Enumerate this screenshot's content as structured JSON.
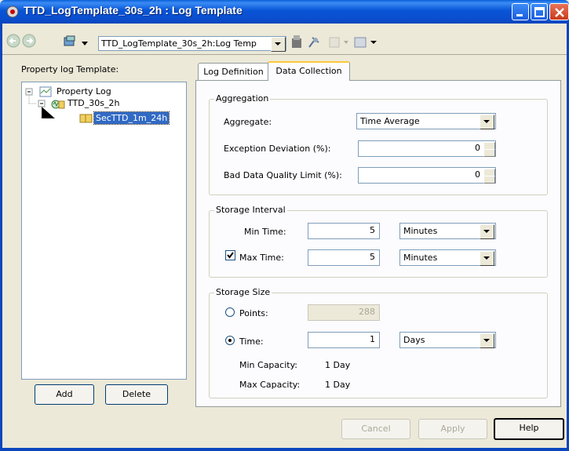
{
  "window": {
    "title": "TTD_LogTemplate_30s_2h : Log Template"
  },
  "toolbar": {
    "address_value": "TTD_LogTemplate_30s_2h:Log Temp"
  },
  "left": {
    "header": "Property log Template:",
    "tree": [
      "Property Log",
      "TTD_30s_2h",
      "SecTTD_1m_24h"
    ],
    "add_label": "Add",
    "delete_label": "Delete"
  },
  "tabs": [
    "Log Definition",
    "Data Collection"
  ],
  "aggregation": {
    "title": "Aggregation",
    "aggregate_label": "Aggregate:",
    "aggregate_value": "Time Average",
    "exception_label": "Exception Deviation (%):",
    "exception_value": "0",
    "baddata_label": "Bad Data Quality Limit (%):",
    "baddata_value": "0"
  },
  "storage_interval": {
    "title": "Storage Interval",
    "min_label": "Min Time:",
    "min_value": "5",
    "min_unit": "Minutes",
    "max_label": "Max Time:",
    "max_checked": true,
    "max_value": "5",
    "max_unit": "Minutes"
  },
  "storage_size": {
    "title": "Storage Size",
    "points_label": "Points:",
    "points_value": "288",
    "time_label": "Time:",
    "time_value": "1",
    "time_unit": "Days",
    "min_cap_label": "Min Capacity:",
    "min_cap_value": "1 Day",
    "max_cap_label": "Max Capacity:",
    "max_cap_value": "1 Day"
  },
  "footer": {
    "cancel_label": "Cancel",
    "apply_label": "Apply",
    "help_label": "Help"
  }
}
